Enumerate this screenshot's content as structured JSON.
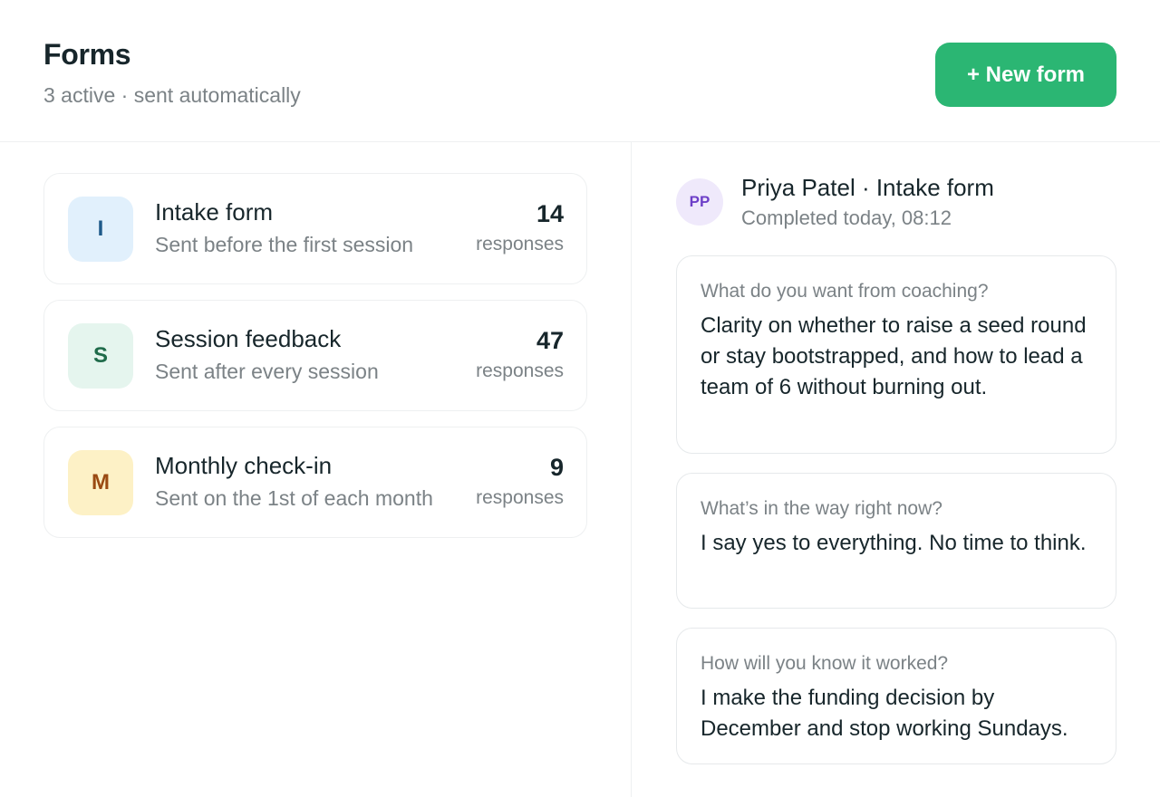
{
  "header": {
    "title": "Forms",
    "subtitle": "3 active · sent automatically",
    "new_form_label": "+ New form"
  },
  "forms": [
    {
      "initial": "I",
      "name": "Intake form",
      "description": "Sent before the first session",
      "count": "14",
      "count_label": "responses",
      "badge_bg": "#e1f0fc",
      "badge_fg": "#1f5a8a"
    },
    {
      "initial": "S",
      "name": "Session feedback",
      "description": "Sent after every session",
      "count": "47",
      "count_label": "responses",
      "badge_bg": "#e5f5ee",
      "badge_fg": "#1f6b4a"
    },
    {
      "initial": "M",
      "name": "Monthly check-in",
      "description": "Sent on the 1st of each month",
      "count": "9",
      "count_label": "responses",
      "badge_bg": "#fdf1c6",
      "badge_fg": "#9a4a12"
    }
  ],
  "response": {
    "avatar_initials": "PP",
    "title": "Priya Patel · Intake form",
    "meta": "Completed today, 08:12",
    "answers": [
      {
        "question": "What do you want from coaching?",
        "answer": "Clarity on whether to raise a seed round or stay bootstrapped, and how to lead a team of 6 without burning out."
      },
      {
        "question": "What’s in the way right now?",
        "answer": "I say yes to everything. No time to think."
      },
      {
        "question": "How will you know it worked?",
        "answer": "I make the funding decision by December and stop working Sundays."
      }
    ]
  },
  "colors": {
    "accent": "#2bb673",
    "avatar_bg": "#efe9fb",
    "avatar_fg": "#6d3fc8"
  }
}
